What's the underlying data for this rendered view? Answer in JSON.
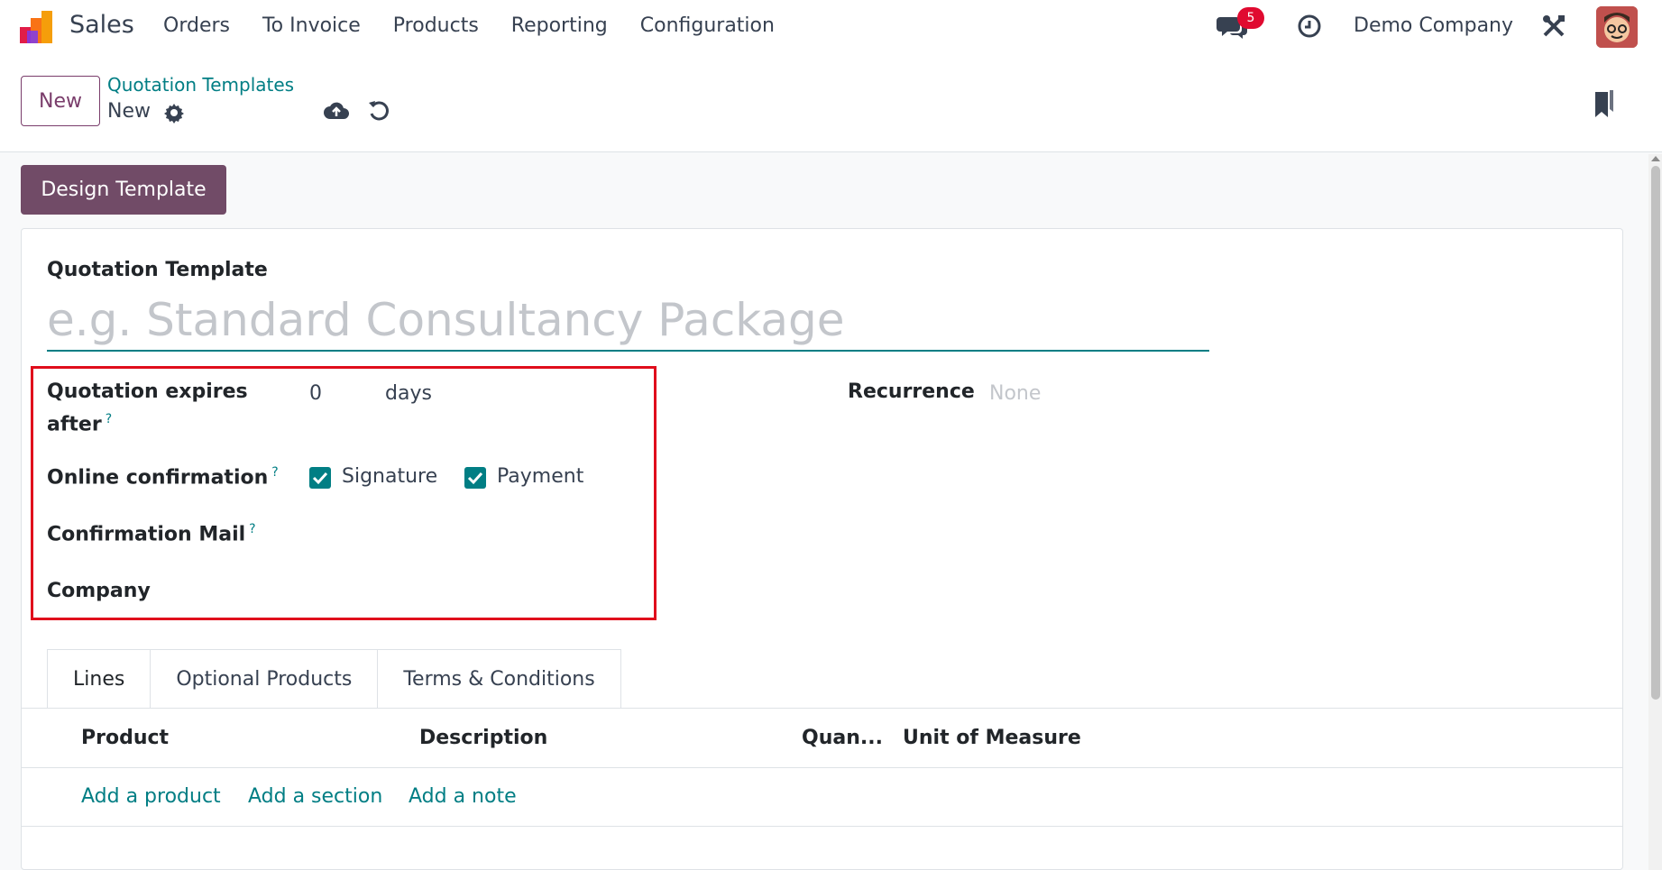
{
  "navbar": {
    "app_name": "Sales",
    "menu": [
      "Orders",
      "To Invoice",
      "Products",
      "Reporting",
      "Configuration"
    ],
    "chat_count": "5",
    "company": "Demo Company",
    "icons": [
      "app-logo-icon",
      "chat-icon",
      "clock-icon",
      "tools-icon",
      "avatar"
    ]
  },
  "control_panel": {
    "new_label": "New",
    "breadcrumb": "Quotation Templates",
    "record_name": "New"
  },
  "form": {
    "design_button": "Design Template",
    "title_label": "Quotation Template",
    "title_placeholder": "e.g. Standard Consultancy Package",
    "expires_label_1": "Quotation expires",
    "expires_label_2": "after",
    "expires_value": "0",
    "expires_unit": "days",
    "online_confirmation_label": "Online confirmation",
    "signature_label": "Signature",
    "signature_checked": true,
    "payment_label": "Payment",
    "payment_checked": true,
    "confirmation_mail_label": "Confirmation Mail",
    "company_label": "Company",
    "recurrence_label": "Recurrence",
    "recurrence_placeholder": "None",
    "help_mark": "?"
  },
  "tabs": [
    "Lines",
    "Optional Products",
    "Terms & Conditions"
  ],
  "lines_table": {
    "columns": [
      "Product",
      "Description",
      "Quan...",
      "Unit of Measure"
    ],
    "add_links": [
      "Add a product",
      "Add a section",
      "Add a note"
    ]
  },
  "colors": {
    "primary": "#714b67",
    "accent": "#017e84",
    "highlight": "#e00d1c",
    "badge": "#e00a30"
  }
}
